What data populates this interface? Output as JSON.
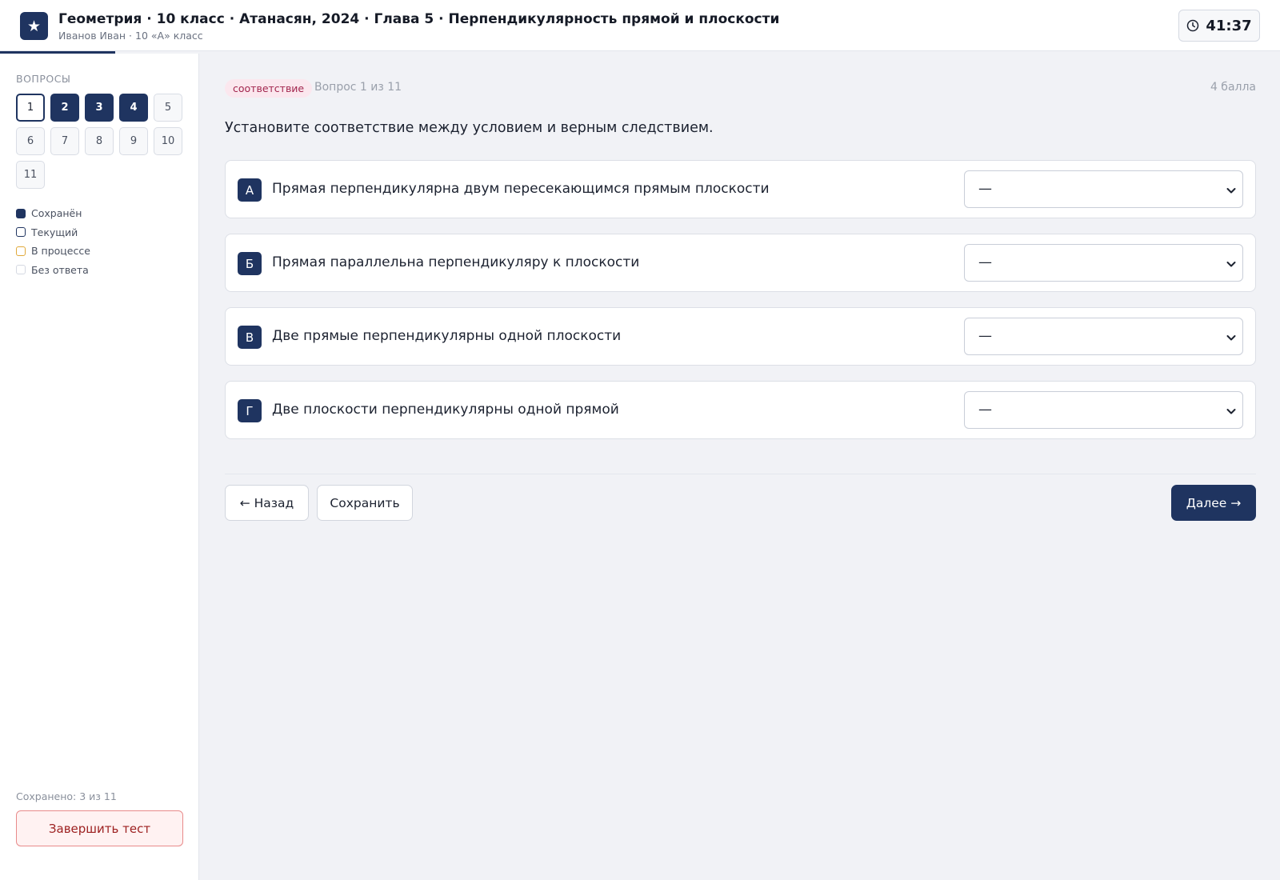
{
  "header": {
    "title": "Геометрия · 10 класс · Атанасян, 2024 · Глава 5 · Перпендикулярность прямой и плоскости",
    "subtitle": "Иванов Иван · 10 «А» класс",
    "timer": "41:37",
    "progress_fraction": 0.09
  },
  "sidebar": {
    "heading": "ВОПРОСЫ",
    "questions": [
      {
        "label": "1",
        "state": "current"
      },
      {
        "label": "2",
        "state": "saved"
      },
      {
        "label": "3",
        "state": "saved"
      },
      {
        "label": "4",
        "state": "saved"
      },
      {
        "label": "5",
        "state": "noanswer"
      },
      {
        "label": "6",
        "state": "noanswer"
      },
      {
        "label": "7",
        "state": "noanswer"
      },
      {
        "label": "8",
        "state": "noanswer"
      },
      {
        "label": "9",
        "state": "noanswer"
      },
      {
        "label": "10",
        "state": "noanswer"
      },
      {
        "label": "11",
        "state": "noanswer"
      }
    ],
    "legend": {
      "saved": "Сохранён",
      "current": "Текущий",
      "inprogress": "В процессе",
      "noanswer": "Без ответа"
    },
    "saved_count": "Сохранено: 3 из 11",
    "finish_label": "Завершить тест"
  },
  "main": {
    "tag": "соответствие",
    "question_number": "Вопрос 1 из 11",
    "points": "4 балла",
    "question_text": "Установите соответствие между условием и верным следствием.",
    "rows": [
      {
        "letter": "А",
        "text": "Прямая перпендикулярна двум пересекающимся прямым плоскости",
        "value": "—"
      },
      {
        "letter": "Б",
        "text": "Прямая параллельна перпендикуляру к плоскости",
        "value": "—"
      },
      {
        "letter": "В",
        "text": "Две прямые перпендикулярны одной плоскости",
        "value": "—"
      },
      {
        "letter": "Г",
        "text": "Две плоскости перпендикулярны одной прямой",
        "value": "—"
      }
    ],
    "back_label": "← Назад",
    "save_label": "Сохранить",
    "next_label": "Далее →"
  },
  "colors": {
    "accent": "#1f3460",
    "inprogress": "#e0a93a",
    "danger": "#9c1f1f",
    "tag_text": "#a2264e"
  }
}
